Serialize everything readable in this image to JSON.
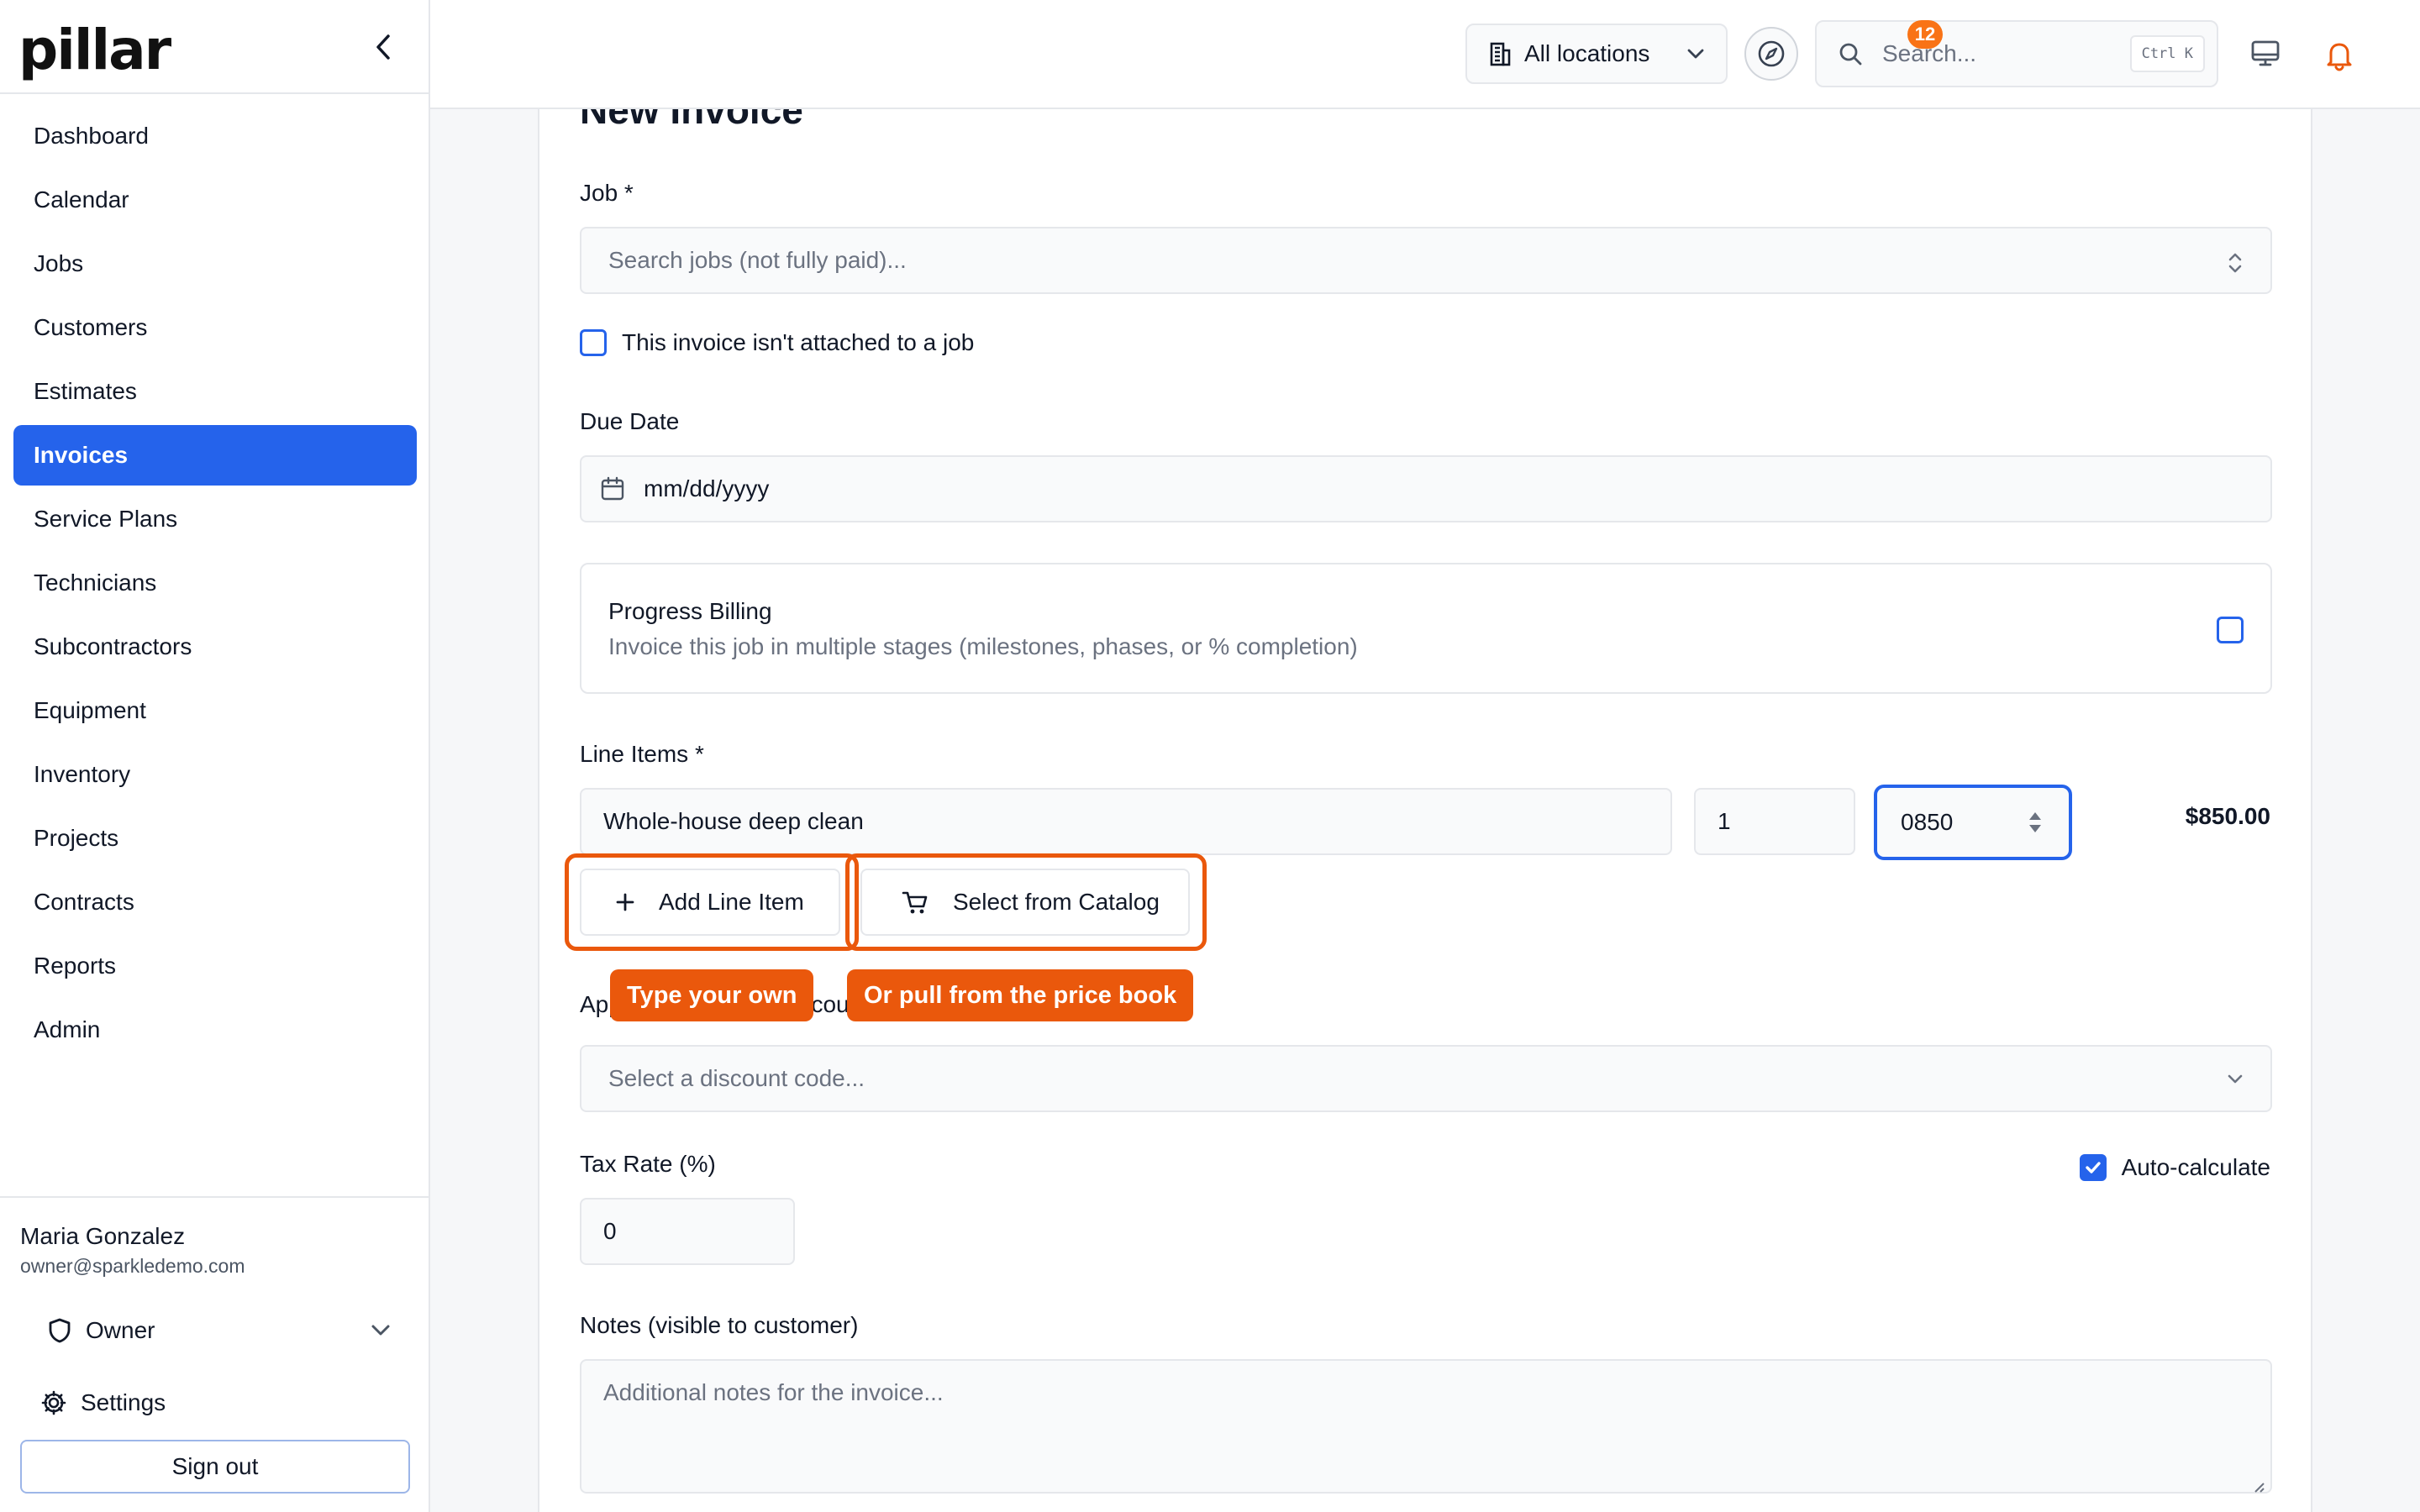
{
  "app": {
    "logo": "pillar"
  },
  "sidebar": {
    "items": [
      {
        "label": "Dashboard"
      },
      {
        "label": "Calendar"
      },
      {
        "label": "Jobs"
      },
      {
        "label": "Customers"
      },
      {
        "label": "Estimates"
      },
      {
        "label": "Invoices",
        "active": true
      },
      {
        "label": "Service Plans"
      },
      {
        "label": "Technicians"
      },
      {
        "label": "Subcontractors"
      },
      {
        "label": "Equipment"
      },
      {
        "label": "Inventory"
      },
      {
        "label": "Projects"
      },
      {
        "label": "Contracts"
      },
      {
        "label": "Reports"
      },
      {
        "label": "Admin"
      }
    ],
    "user": {
      "name": "Maria Gonzalez",
      "email": "owner@sparkledemo.com",
      "role": "Owner",
      "settings_label": "Settings",
      "signout_label": "Sign out"
    }
  },
  "topbar": {
    "location": "All locations",
    "search_placeholder": "Search...",
    "shortcut": "Ctrl K",
    "notification_count": "12"
  },
  "form": {
    "title": "New Invoice",
    "job_label": "Job *",
    "job_placeholder": "Search jobs (not fully paid)...",
    "no_job_label": "This invoice isn't attached to a job",
    "due_date_label": "Due Date",
    "due_date_placeholder": "mm/dd/yyyy",
    "progress_billing": {
      "title": "Progress Billing",
      "description": "Invoice this job in multiple stages (milestones, phases, or % completion)"
    },
    "line_items_label": "Line Items *",
    "line_item": {
      "description": "Whole-house deep clean",
      "quantity": "1",
      "price": "0850",
      "total": "$850.00"
    },
    "add_line_item_label": "Add Line Item",
    "select_catalog_label": "Select from Catalog",
    "discount_label": "Apply Promotional Discount",
    "discount_placeholder": "Select a discount code...",
    "tax_rate_label": "Tax Rate (%)",
    "tax_rate_value": "0",
    "auto_calc_label": "Auto-calculate",
    "notes_label": "Notes (visible to customer)",
    "notes_placeholder": "Additional notes for the invoice..."
  },
  "tooltips": {
    "type_own": "Type your own",
    "price_book": "Or pull from the price book"
  },
  "colors": {
    "accent": "#2563eb",
    "highlight": "#ea580c",
    "badge": "#f97316"
  }
}
